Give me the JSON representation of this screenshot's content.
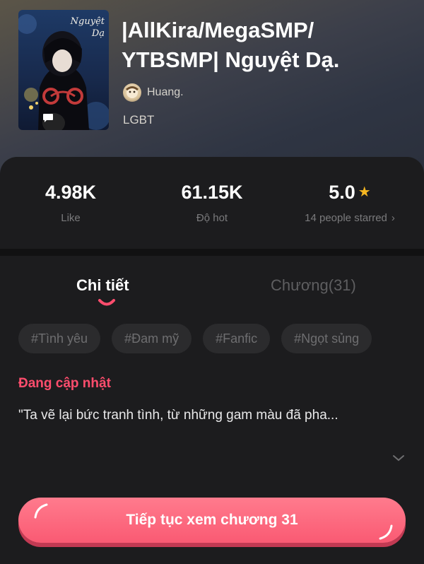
{
  "book": {
    "title": "|AllKira/MegaSMP/ YTBSMP| Nguyệt Dạ.",
    "cover_text": "Nguyệt Dạ",
    "author": "Huang.",
    "genre": "LGBT"
  },
  "stats": {
    "likes": "4.98K",
    "likes_label": "Like",
    "hot": "61.15K",
    "hot_label": "Độ hot",
    "rating": "5.0",
    "rating_label": "14 people starred"
  },
  "tabs": [
    {
      "label": "Chi tiết",
      "active": true
    },
    {
      "label": "Chương(31)",
      "active": false
    }
  ],
  "tags": [
    "#Tình yêu",
    "#Đam mỹ",
    "#Fanfic",
    "#Ngọt sủng"
  ],
  "status": "Đang cập nhật",
  "description": "\"Ta vẽ lại bức tranh tình, từ những gam màu đã pha...",
  "cta_label": "Tiếp tục xem chương 31",
  "colors": {
    "accent": "#ff4d6d",
    "cta": "#fa5a73",
    "star": "#f5b621",
    "panel": "#1c1c1e"
  },
  "icons": [
    "star-icon",
    "chevron-right-icon",
    "chevron-down-icon",
    "chat-bubble-icon"
  ]
}
